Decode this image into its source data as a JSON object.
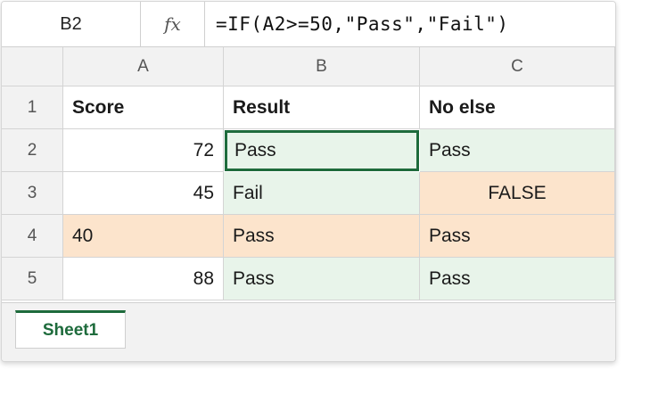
{
  "formula_bar": {
    "name_box": "B2",
    "fx_label": "fx",
    "formula": "=IF(A2>=50,\"Pass\",\"Fail\")"
  },
  "columns": [
    "A",
    "B",
    "C"
  ],
  "rows": [
    {
      "num": "1",
      "a": "Score",
      "b": "Result",
      "c": "No else"
    },
    {
      "num": "2",
      "a": "72",
      "b": "Pass",
      "c": "Pass"
    },
    {
      "num": "3",
      "a": "45",
      "b": "Fail",
      "c": "FALSE"
    },
    {
      "num": "4",
      "a": "40",
      "b": "Pass",
      "c": "Pass"
    },
    {
      "num": "5",
      "a": "88",
      "b": "Pass",
      "c": "Pass"
    }
  ],
  "sheet_tabs": [
    "Sheet1"
  ],
  "colors": {
    "accent": "#1e6b3c",
    "green_fill": "#e8f4ea",
    "orange_fill": "#fce4cc",
    "header_fill": "#f2f2f2"
  }
}
